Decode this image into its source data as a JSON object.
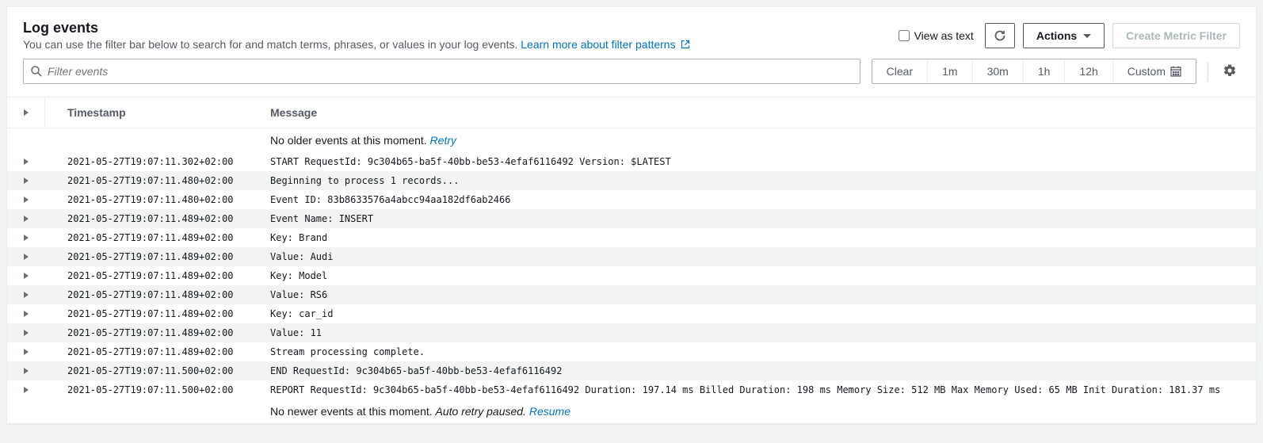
{
  "header": {
    "title": "Log events",
    "subtitle_text": "You can use the filter bar below to search for and match terms, phrases, or values in your log events. ",
    "learn_more_label": "Learn more about filter patterns"
  },
  "controls": {
    "view_as_text_label": "View as text",
    "actions_label": "Actions",
    "create_filter_label": "Create Metric Filter"
  },
  "search": {
    "placeholder": "Filter events"
  },
  "time_buttons": {
    "clear": "Clear",
    "m1": "1m",
    "m30": "30m",
    "h1": "1h",
    "h12": "12h",
    "custom": "Custom"
  },
  "columns": {
    "timestamp": "Timestamp",
    "message": "Message"
  },
  "notice_top": {
    "text": "No older events at this moment. ",
    "link": "Retry"
  },
  "notice_bottom": {
    "text": "No newer events at this moment. ",
    "italic": "Auto retry paused. ",
    "link": "Resume"
  },
  "rows": [
    {
      "ts": "2021-05-27T19:07:11.302+02:00",
      "msg": "START RequestId: 9c304b65-ba5f-40bb-be53-4efaf6116492 Version: $LATEST"
    },
    {
      "ts": "2021-05-27T19:07:11.480+02:00",
      "msg": "Beginning to process 1 records..."
    },
    {
      "ts": "2021-05-27T19:07:11.480+02:00",
      "msg": "Event ID: 83b8633576a4abcc94aa182df6ab2466"
    },
    {
      "ts": "2021-05-27T19:07:11.489+02:00",
      "msg": "Event Name: INSERT"
    },
    {
      "ts": "2021-05-27T19:07:11.489+02:00",
      "msg": "Key: Brand"
    },
    {
      "ts": "2021-05-27T19:07:11.489+02:00",
      "msg": "Value: Audi"
    },
    {
      "ts": "2021-05-27T19:07:11.489+02:00",
      "msg": "Key: Model"
    },
    {
      "ts": "2021-05-27T19:07:11.489+02:00",
      "msg": "Value: RS6"
    },
    {
      "ts": "2021-05-27T19:07:11.489+02:00",
      "msg": "Key: car_id"
    },
    {
      "ts": "2021-05-27T19:07:11.489+02:00",
      "msg": "Value: 11"
    },
    {
      "ts": "2021-05-27T19:07:11.489+02:00",
      "msg": "Stream processing complete."
    },
    {
      "ts": "2021-05-27T19:07:11.500+02:00",
      "msg": "END RequestId: 9c304b65-ba5f-40bb-be53-4efaf6116492"
    },
    {
      "ts": "2021-05-27T19:07:11.500+02:00",
      "msg": "REPORT RequestId: 9c304b65-ba5f-40bb-be53-4efaf6116492 Duration: 197.14 ms Billed Duration: 198 ms Memory Size: 512 MB Max Memory Used: 65 MB Init Duration: 181.37 ms"
    }
  ]
}
